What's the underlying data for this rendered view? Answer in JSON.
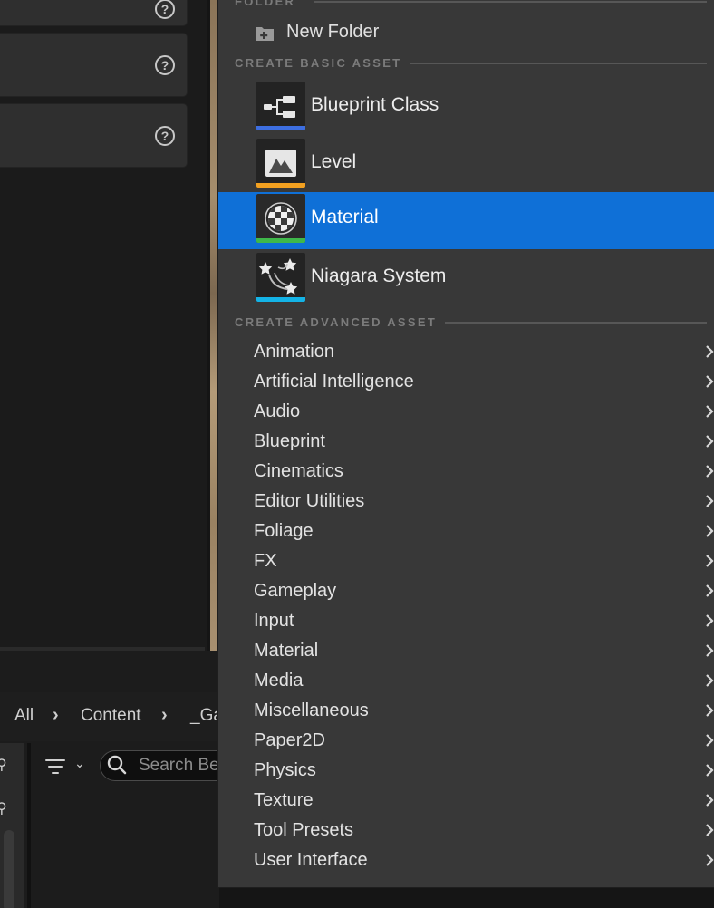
{
  "background": {
    "breadcrumb": [
      "All",
      "Content",
      "_Ga"
    ],
    "search_placeholder": "Search Be"
  },
  "menu": {
    "sections": {
      "folder": "FOLDER",
      "basic": "CREATE BASIC ASSET",
      "advanced": "CREATE ADVANCED ASSET"
    },
    "new_folder": {
      "label": "New Folder",
      "icon": "new-folder-icon"
    },
    "basic_assets": [
      {
        "label": "Blueprint Class",
        "icon": "blueprint-class-icon",
        "stripe_color": "#3d6ee0",
        "highlighted": false
      },
      {
        "label": "Level",
        "icon": "level-icon",
        "stripe_color": "#f2a020",
        "highlighted": false
      },
      {
        "label": "Material",
        "icon": "material-icon",
        "stripe_color": "#3fb84a",
        "highlighted": true
      },
      {
        "label": "Niagara System",
        "icon": "niagara-system-icon",
        "stripe_color": "#14b3e6",
        "highlighted": false
      }
    ],
    "advanced_assets": [
      "Animation",
      "Artificial Intelligence",
      "Audio",
      "Blueprint",
      "Cinematics",
      "Editor Utilities",
      "Foliage",
      "FX",
      "Gameplay",
      "Input",
      "Material",
      "Media",
      "Miscellaneous",
      "Paper2D",
      "Physics",
      "Texture",
      "Tool Presets",
      "User Interface"
    ],
    "highlight_color": "#0f70d7"
  }
}
